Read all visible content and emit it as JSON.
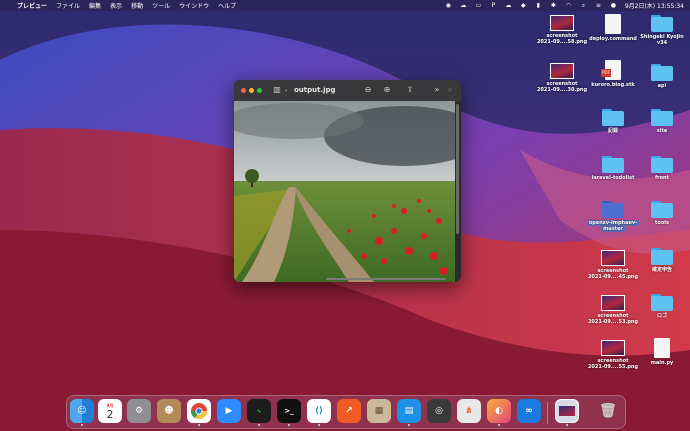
{
  "menubar": {
    "apple": "",
    "app_name": "プレビュー",
    "menus": [
      "ファイル",
      "編集",
      "表示",
      "移動",
      "ツール",
      "ウインドウ",
      "ヘルプ"
    ],
    "status": {
      "letter_p": "P",
      "datetime": "9月2日(木) 13:55:34"
    }
  },
  "window": {
    "title": "output.jpg",
    "icons": [
      "sidebar-icon",
      "zoom-out-icon",
      "zoom-in-icon",
      "share-icon",
      "more-icon",
      "search-icon"
    ]
  },
  "desktop": {
    "items": [
      {
        "label1": "screenshot",
        "label2": "2021-09....58.png",
        "kind": "thumb"
      },
      {
        "label1": "deploy.command",
        "label2": "",
        "kind": "doc"
      },
      {
        "label1": "Shingeki Kyojin",
        "label2": "v34",
        "kind": "folder"
      },
      {
        "label1": "screenshot",
        "label2": "2021-09....30.png",
        "kind": "thumb"
      },
      {
        "label1": "kuroro.blog.stk",
        "label2": "",
        "kind": "doc-pdf"
      },
      {
        "label1": "api",
        "label2": "",
        "kind": "folder"
      },
      {
        "label1": "記録",
        "label2": "",
        "kind": "folder"
      },
      {
        "label1": "site",
        "label2": "",
        "kind": "folder"
      },
      {
        "label1": "laravel-todolist",
        "label2": "",
        "kind": "folder"
      },
      {
        "label1": "front",
        "label2": "",
        "kind": "folder"
      },
      {
        "label1": "openzv-imphaev-",
        "label2": "master",
        "kind": "folder-selected"
      },
      {
        "label1": "tools",
        "label2": "",
        "kind": "folder"
      },
      {
        "label1": "screenshot",
        "label2": "2021-09....45.png",
        "kind": "thumb"
      },
      {
        "label1": "確定申告",
        "label2": "",
        "kind": "folder"
      },
      {
        "label1": "screenshot",
        "label2": "2021-09....53.png",
        "kind": "thumb"
      },
      {
        "label1": "ロゴ",
        "label2": "",
        "kind": "folder"
      },
      {
        "label1": "screenshot",
        "label2": "2021-09....55.png",
        "kind": "thumb"
      },
      {
        "label1": "main.py",
        "label2": "",
        "kind": "doc"
      }
    ]
  },
  "dock": {
    "calendar_month": "9月",
    "calendar_day": "2",
    "apps": [
      "Finder",
      "Calendar",
      "System Preferences",
      "Contacts",
      "Chrome",
      "Zoom",
      "Activity Monitor",
      "Terminal",
      "VS Code",
      "Instastats",
      "Archive Utility",
      "Docker",
      "QuickTime",
      "Sourcetree",
      "Preview",
      "Infinity",
      "Screenshot",
      "Trash"
    ]
  },
  "colors": {
    "accent_folder": "#5ec2f3",
    "wallpaper_red": "#b3263c",
    "wallpaper_purple": "#3b2a7a"
  }
}
